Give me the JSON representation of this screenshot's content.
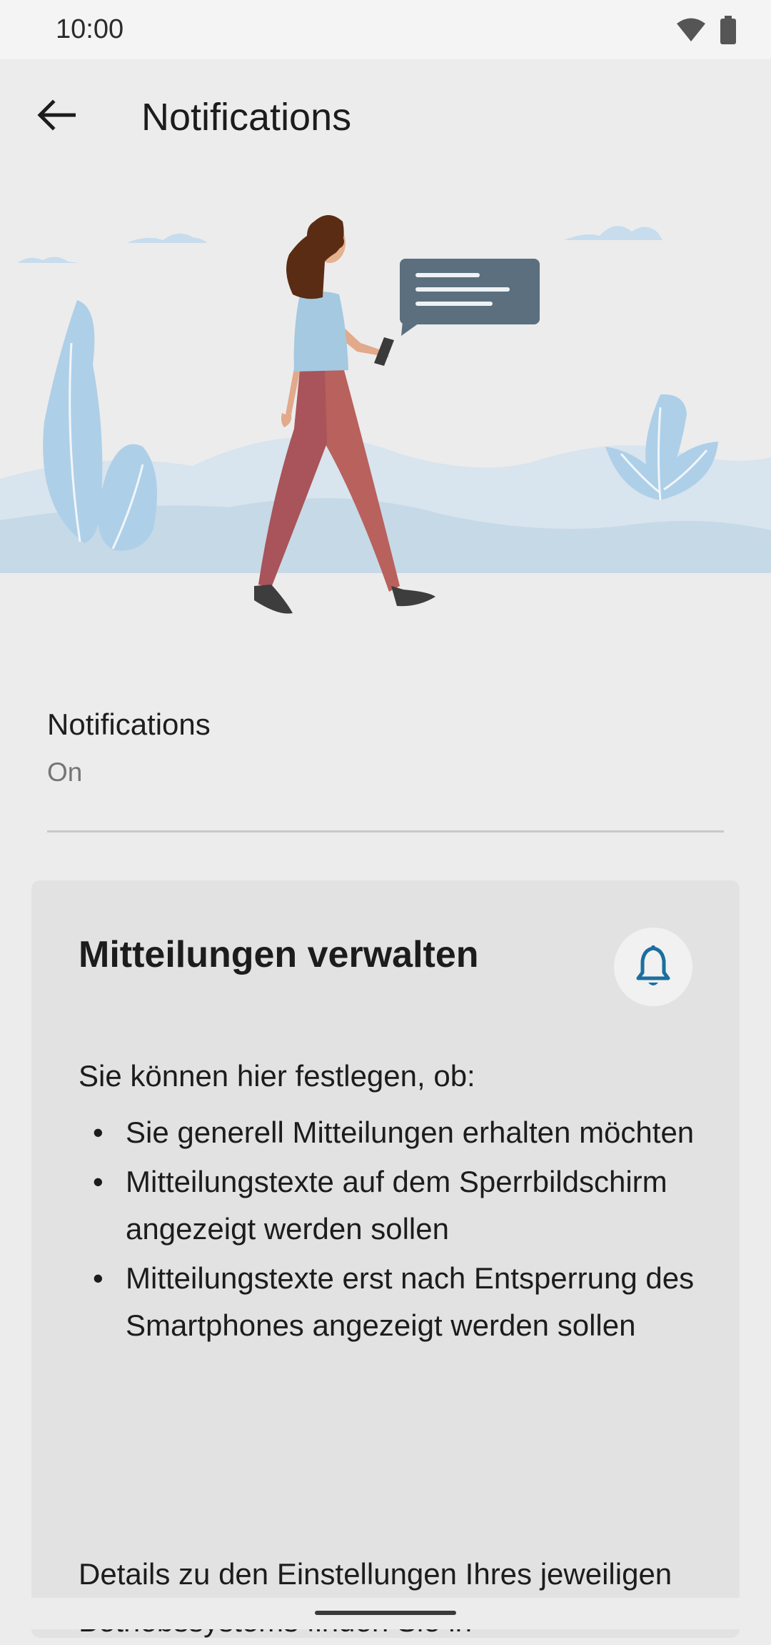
{
  "status_bar": {
    "time": "10:00"
  },
  "app_bar": {
    "title": "Notifications"
  },
  "preference": {
    "title": "Notifications",
    "summary": "On"
  },
  "card": {
    "title": "Mitteilungen verwalten",
    "intro": "Sie können hier festlegen, ob:",
    "items": [
      "Sie generell Mitteilungen erhalten möchten",
      "Mitteilungstexte auf dem Sperrbildschirm angezeigt werden sollen",
      "Mitteilungstexte erst nach Entsperrung des Smartphones angezeigt werden sollen"
    ],
    "details": "Details zu den Einstellungen Ihres jeweiligen Betriebssystems finden Sie in"
  },
  "colors": {
    "accent": "#1a6fa0",
    "background": "#ececec",
    "card": "#e2e2e2"
  },
  "icons": [
    "wifi-icon",
    "battery-icon",
    "back-arrow-icon",
    "bell-icon"
  ]
}
